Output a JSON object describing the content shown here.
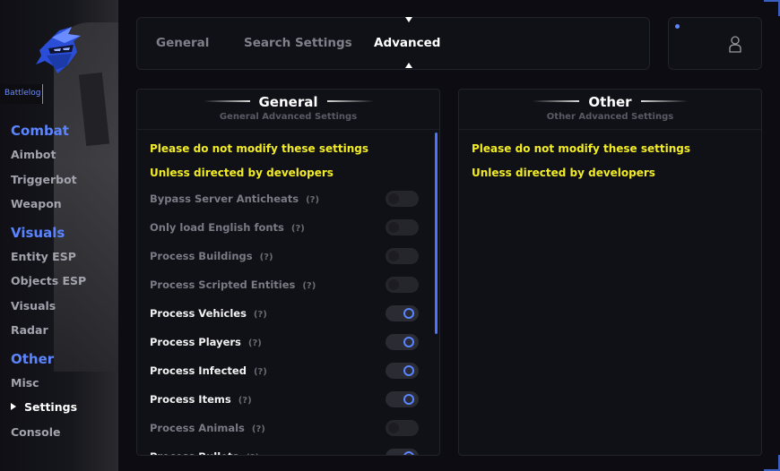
{
  "brand": "Battlelog",
  "sidebar": {
    "sections": [
      {
        "title": "Combat",
        "items": [
          "Aimbot",
          "Triggerbot",
          "Weapon"
        ]
      },
      {
        "title": "Visuals",
        "items": [
          "Entity ESP",
          "Objects ESP",
          "Visuals",
          "Radar"
        ]
      },
      {
        "title": "Other",
        "items": [
          "Misc",
          "Settings",
          "Console"
        ]
      }
    ],
    "active_item": "Settings"
  },
  "tabs": [
    {
      "label": "General",
      "active": false
    },
    {
      "label": "Search Settings",
      "active": false
    },
    {
      "label": "Advanced",
      "active": true
    }
  ],
  "profile": {
    "icon": "user-icon",
    "status_color": "#5b84ff"
  },
  "panels": {
    "left": {
      "title": "General",
      "subtitle": "General Advanced Settings",
      "warning_1": "Please do not modify these settings",
      "warning_2": "Unless directed by developers",
      "help_marker": "(?)",
      "options": [
        {
          "label": "Bypass Server Anticheats",
          "enabled": false
        },
        {
          "label": "Only load English fonts",
          "enabled": false
        },
        {
          "label": "Process Buildings",
          "enabled": false
        },
        {
          "label": "Process Scripted Entities",
          "enabled": false
        },
        {
          "label": "Process Vehicles",
          "enabled": true
        },
        {
          "label": "Process Players",
          "enabled": true
        },
        {
          "label": "Process Infected",
          "enabled": true
        },
        {
          "label": "Process Items",
          "enabled": true
        },
        {
          "label": "Process Animals",
          "enabled": false
        },
        {
          "label": "Process Bullets",
          "enabled": true
        }
      ]
    },
    "right": {
      "title": "Other",
      "subtitle": "Other Advanced Settings",
      "warning_1": "Please do not modify these settings",
      "warning_2": "Unless directed by developers"
    }
  },
  "colors": {
    "accent": "#5b84ff",
    "warning": "#f2ec26",
    "background": "#0c0c12"
  }
}
